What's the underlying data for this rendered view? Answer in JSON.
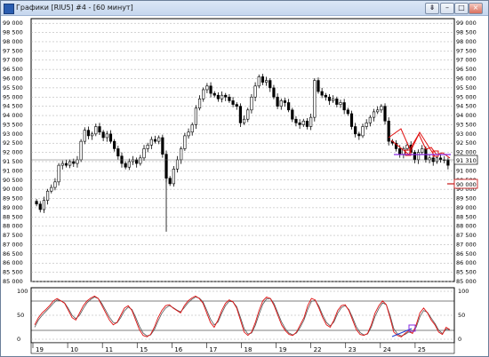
{
  "window": {
    "title": "Графики [RIU5] #4 - [60 минут]",
    "buttons": {
      "pin": "⇟",
      "minimize": "–",
      "maximize": "□",
      "close": "×"
    }
  },
  "price_axis": {
    "labels": [
      "99 000",
      "98 500",
      "98 000",
      "97 500",
      "97 000",
      "96 500",
      "96 000",
      "95 500",
      "95 000",
      "94 500",
      "94 000",
      "93 500",
      "93 000",
      "92 500",
      "92 000",
      "91 500",
      "91 000",
      "90 500",
      "90 000",
      "89 500",
      "89 000",
      "88 500",
      "88 000",
      "87 500",
      "87 000",
      "86 500",
      "86 000",
      "85 500",
      "85 000"
    ],
    "current_price_tag": "91 310",
    "level_tag": "90 000"
  },
  "oscillator_axis": {
    "labels": [
      "100",
      "50",
      "0"
    ]
  },
  "time_axis": {
    "labels": [
      "19",
      "10",
      "11",
      "15",
      "16",
      "17",
      "18",
      "19",
      "22",
      "23",
      "24",
      "25"
    ]
  },
  "colors": {
    "candle": "#000000",
    "grid": "#a8a8a8",
    "drawing": "#e01010",
    "support_line": "#8a2be2",
    "osc_fast": "#e01010",
    "osc_slow": "#555555",
    "osc_trend": "#2040d0",
    "level_line": "#c81e1e"
  },
  "chart_data": [
    {
      "type": "candlestick",
      "title": "",
      "ylim": [
        85000,
        99250
      ],
      "close_series": [
        89200,
        88900,
        89400,
        89900,
        90100,
        90400,
        91300,
        91400,
        91300,
        91500,
        91400,
        91600,
        92600,
        93200,
        92900,
        93000,
        93400,
        93100,
        92800,
        93000,
        92600,
        92200,
        91800,
        91400,
        91200,
        91500,
        91600,
        91400,
        91700,
        92200,
        92400,
        92700,
        92600,
        92800,
        91900,
        90600,
        90300,
        91100,
        91600,
        92200,
        92900,
        93100,
        93500,
        94400,
        94900,
        95400,
        95600,
        95200,
        95100,
        94900,
        95100,
        95000,
        94800,
        94600,
        94500,
        93600,
        93800,
        94300,
        95000,
        95600,
        96100,
        95800,
        95900,
        95500,
        95000,
        94500,
        94800,
        94700,
        94300,
        93800,
        93600,
        93500,
        93700,
        93400,
        93900,
        95900,
        95300,
        95100,
        95000,
        94800,
        94900,
        94600,
        94700,
        94300,
        94100,
        93400,
        93000,
        92900,
        93400,
        93600,
        93900,
        94200,
        94300,
        94500,
        93700,
        92600,
        92500,
        92200,
        91900,
        92200,
        92400,
        92000,
        91600,
        92000,
        92200,
        91600,
        91700,
        91500,
        91700,
        91600,
        91600,
        91300
      ],
      "current_price": 91310,
      "horizontal_level": 90000
    },
    {
      "type": "line",
      "title": "",
      "ylim": [
        0,
        100
      ],
      "series": [
        {
          "values": [
            30,
            45,
            55,
            62,
            70,
            80,
            85,
            80,
            75,
            60,
            45,
            40,
            55,
            70,
            80,
            86,
            90,
            85,
            70,
            55,
            40,
            30,
            35,
            50,
            65,
            70,
            60,
            40,
            20,
            8,
            5,
            10,
            25,
            45,
            60,
            70,
            72,
            65,
            60,
            55,
            70,
            80,
            86,
            90,
            85,
            75,
            55,
            35,
            25,
            40,
            60,
            75,
            82,
            78,
            65,
            40,
            15,
            8,
            15,
            35,
            60,
            80,
            88,
            85,
            70,
            50,
            30,
            18,
            10,
            8,
            15,
            30,
            45,
            70,
            85,
            82,
            65,
            45,
            30,
            25,
            40,
            60,
            70,
            72,
            60,
            40,
            20,
            10,
            8,
            12,
            30,
            55,
            70,
            80,
            72,
            45,
            15,
            8,
            5,
            12,
            18,
            12,
            30,
            55,
            65,
            55,
            40,
            30,
            15,
            10,
            25,
            20
          ]
        },
        {
          "values": [
            25,
            40,
            50,
            58,
            66,
            75,
            82,
            80,
            76,
            64,
            50,
            43,
            50,
            64,
            76,
            83,
            88,
            85,
            74,
            60,
            46,
            35,
            34,
            45,
            59,
            67,
            62,
            46,
            27,
            13,
            7,
            9,
            20,
            38,
            54,
            65,
            70,
            66,
            61,
            57,
            66,
            76,
            83,
            88,
            86,
            78,
            61,
            42,
            30,
            36,
            54,
            70,
            79,
            78,
            68,
            46,
            22,
            11,
            13,
            29,
            52,
            73,
            84,
            85,
            74,
            55,
            36,
            22,
            13,
            9,
            13,
            25,
            40,
            62,
            79,
            81,
            69,
            50,
            35,
            28,
            36,
            54,
            66,
            70,
            62,
            45,
            26,
            14,
            9,
            11,
            25,
            48,
            64,
            76,
            72,
            50,
            22,
            11,
            7,
            10,
            15,
            13,
            25,
            47,
            60,
            56,
            44,
            33,
            19,
            12,
            21,
            20
          ]
        }
      ]
    }
  ]
}
